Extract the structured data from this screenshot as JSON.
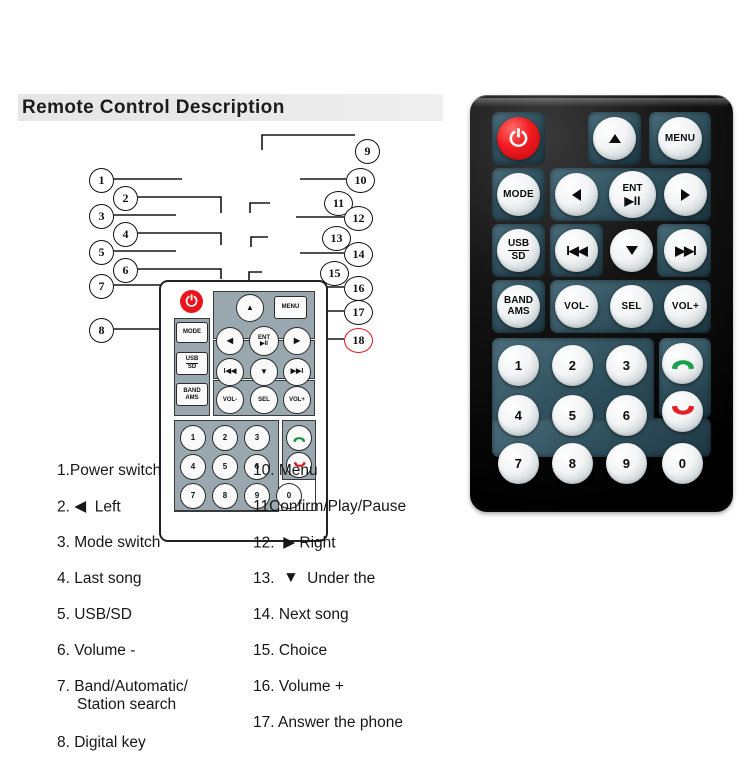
{
  "header": {
    "title": "Remote Control Description"
  },
  "small_remote": {
    "alt": "remote-control-line-diagram",
    "keys": {
      "power": "power-icon",
      "mode": "MODE",
      "usb_sd": [
        "USB",
        "SD"
      ],
      "band_ams": [
        "BAND",
        "AMS"
      ],
      "up": "▲",
      "down": "▼",
      "left": "◀",
      "right": "▶",
      "menu": "MENU",
      "ent": "ENT",
      "playpause": "▶II",
      "prev": "I◀◀",
      "next": "▶▶I",
      "vol_down": "VOL-",
      "vol_up": "VOL+",
      "sel": "SEL",
      "numbers": [
        "1",
        "2",
        "3",
        "4",
        "5",
        "6",
        "7",
        "8",
        "9",
        "0"
      ],
      "call_answer": "answer-call-icon",
      "call_end": "end-call-icon"
    },
    "callouts": [
      {
        "n": "1"
      },
      {
        "n": "2"
      },
      {
        "n": "3"
      },
      {
        "n": "4"
      },
      {
        "n": "5"
      },
      {
        "n": "6"
      },
      {
        "n": "7"
      },
      {
        "n": "8"
      },
      {
        "n": "9"
      },
      {
        "n": "10"
      },
      {
        "n": "11"
      },
      {
        "n": "12"
      },
      {
        "n": "13"
      },
      {
        "n": "14"
      },
      {
        "n": "15"
      },
      {
        "n": "16"
      },
      {
        "n": "17"
      },
      {
        "n": "18"
      }
    ]
  },
  "photo_remote": {
    "alt": "remote-control-photo",
    "labels": {
      "power": "power-icon",
      "up": "▲",
      "menu": "MENU",
      "mode": "MODE",
      "left": "◀",
      "ent": "ENT",
      "playpause": "▶II",
      "right": "▶",
      "usb": "USB",
      "sd": "SD",
      "prev": "I◀◀",
      "down": "▼",
      "next": "▶▶I",
      "band": "BAND",
      "ams": "AMS",
      "vol_down": "VOL-",
      "sel": "SEL",
      "vol_up": "VOL+",
      "n1": "1",
      "n2": "2",
      "n3": "3",
      "n4": "4",
      "n5": "5",
      "n6": "6",
      "n7": "7",
      "n8": "8",
      "n9": "9",
      "n0": "0",
      "answer": "answer-call-icon",
      "hangup": "end-call-icon"
    }
  },
  "descriptions": {
    "left_column": [
      {
        "text": "1.Power switch"
      },
      {
        "text": "2.",
        "glyph": "◀",
        "after": "Left"
      },
      {
        "text": "3. Mode switch"
      },
      {
        "text": "4. Last song"
      },
      {
        "text": "5. USB/SD"
      },
      {
        "text": "6. Volume -"
      },
      {
        "text": "7. Band/Automatic/",
        "line2": "Station search"
      },
      {
        "text": "8. Digital key"
      }
    ],
    "right_column": [
      {
        "text": "10. Menu"
      },
      {
        "text": "11Confirm/Play/Pause"
      },
      {
        "text": "12.",
        "glyph": "▶",
        "after": "Right"
      },
      {
        "text": "13.",
        "glyph": "▼",
        "after": "Under the"
      },
      {
        "text": "14. Next song"
      },
      {
        "text": "15. Choice"
      },
      {
        "text": "16. Volume +"
      },
      {
        "text": "17. Answer the phone"
      }
    ]
  },
  "colors": {
    "header_bar": "#e8e8e8",
    "power_red": "#e8131b",
    "keypad_grey": "#98a8ae",
    "photo_body": "#000000",
    "photo_pad": "#31525f",
    "answer_green": "#19a04a",
    "end_red": "#e31f26"
  }
}
